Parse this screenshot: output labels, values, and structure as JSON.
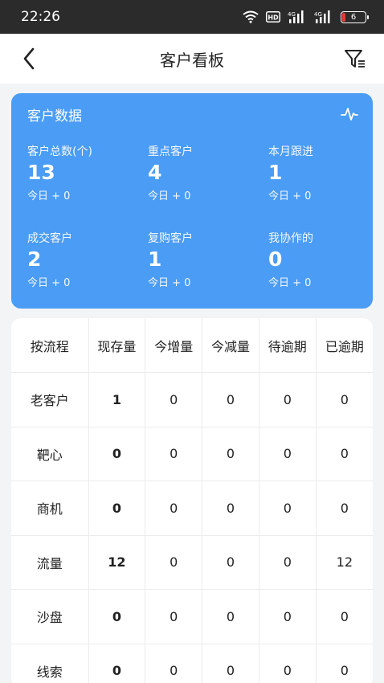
{
  "status_bar": {
    "time": "22:26",
    "battery": "6"
  },
  "nav": {
    "title": "客户看板"
  },
  "summary": {
    "title": "客户数据",
    "stats": [
      {
        "label": "客户总数(个)",
        "value": "13",
        "today": "今日 + 0"
      },
      {
        "label": "重点客户",
        "value": "4",
        "today": "今日 + 0"
      },
      {
        "label": "本月跟进",
        "value": "1",
        "today": "今日 + 0"
      },
      {
        "label": "成交客户",
        "value": "2",
        "today": "今日 + 0"
      },
      {
        "label": "复购客户",
        "value": "1",
        "today": "今日 + 0"
      },
      {
        "label": "我协作的",
        "value": "0",
        "today": "今日 + 0"
      }
    ]
  },
  "table": {
    "headers": [
      "按流程",
      "现存量",
      "今增量",
      "今减量",
      "待逾期",
      "已逾期"
    ],
    "rows": [
      [
        "老客户",
        "1",
        "0",
        "0",
        "0",
        "0"
      ],
      [
        "靶心",
        "0",
        "0",
        "0",
        "0",
        "0"
      ],
      [
        "商机",
        "0",
        "0",
        "0",
        "0",
        "0"
      ],
      [
        "流量",
        "12",
        "0",
        "0",
        "0",
        "12"
      ],
      [
        "沙盘",
        "0",
        "0",
        "0",
        "0",
        "0"
      ],
      [
        "线索",
        "0",
        "0",
        "0",
        "0",
        "0"
      ]
    ]
  },
  "colors": {
    "accent": "#4a9cf5",
    "statusbar": "#2b2b2b",
    "background": "#f3f4f6"
  }
}
